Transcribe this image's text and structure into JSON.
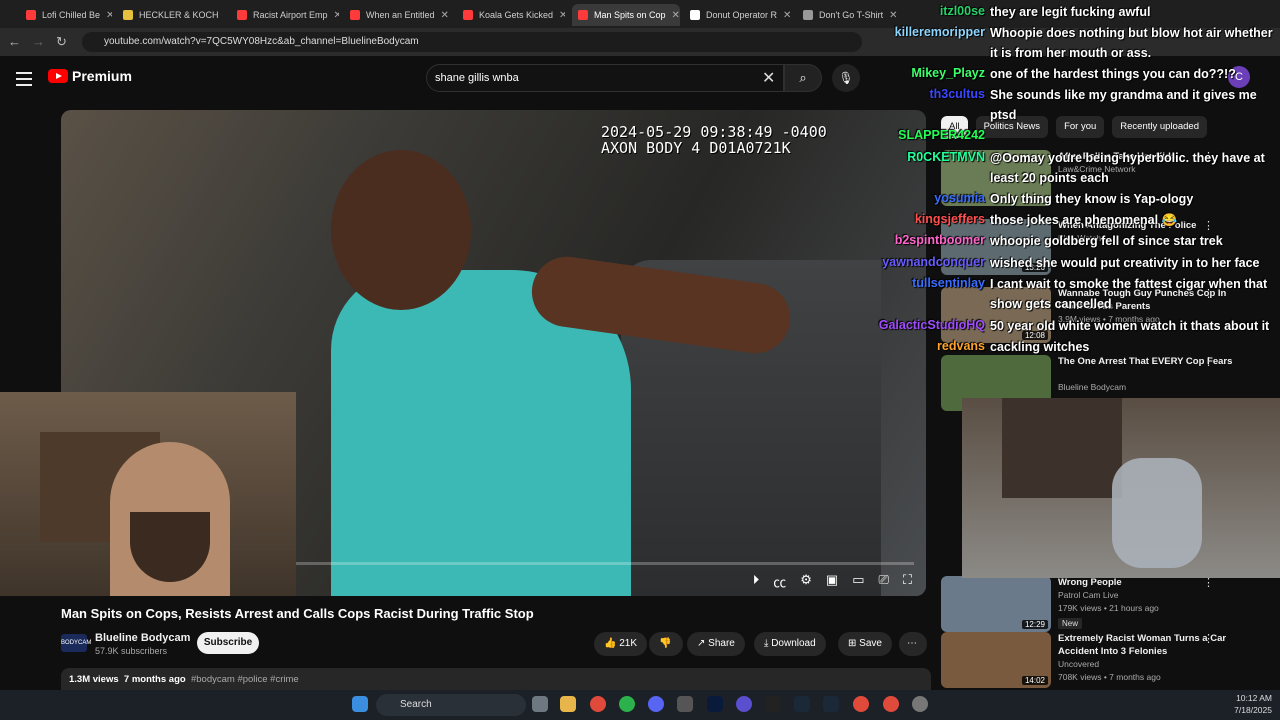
{
  "tabs": [
    {
      "label": "Lofi Chilled Be",
      "color": "#ff3a3a"
    },
    {
      "label": "HECKLER & KOCH",
      "color": "#e5c03c"
    },
    {
      "label": "Racist Airport Emp",
      "color": "#ff3a3a"
    },
    {
      "label": "When an Entitled",
      "color": "#ff3a3a"
    },
    {
      "label": "Koala Gets Kicked",
      "color": "#ff3a3a"
    },
    {
      "label": "Man Spits on Cop",
      "color": "#ff3a3a"
    },
    {
      "label": "Donut Operator R",
      "color": "#ffffff"
    },
    {
      "label": "Don't Go T-Shirt",
      "color": "#999999"
    }
  ],
  "address": {
    "url": "youtube.com/watch?v=7QC5WY08Hzc&ab_channel=BluelineBodycam"
  },
  "header": {
    "logo": "Premium",
    "search_value": "shane gillis wnba",
    "avatar_letter": "C"
  },
  "video": {
    "stamp_line1": "2024-05-29 09:38:49 -0400",
    "stamp_line2": "AXON BODY 4 D01A0721K",
    "progress": 0.0
  },
  "title": "Man Spits on Cops, Resists Arrest and Calls Cops Racist During Traffic Stop",
  "channel": {
    "name": "Blueline Bodycam",
    "subs": "57.9K subscribers",
    "avatar_text": "BODYCAM",
    "subscribe": "Subscribe"
  },
  "actions": {
    "likes": "21K",
    "share": "Share",
    "download": "Download",
    "save": "Save"
  },
  "meta": {
    "views": "1.3M views",
    "age": "7 months ago",
    "tags": "#bodycam #police #crime"
  },
  "filters": [
    "All",
    "Politics News",
    "For you",
    "Recently uploaded"
  ],
  "recs": [
    {
      "title": "After Police Take Her Kids",
      "channel": "Law&Crime Network",
      "meta": "",
      "dur": ""
    },
    {
      "title": "When Antagonizing The Police",
      "channel": "Blue Watch",
      "meta": "",
      "dur": "13:26"
    },
    {
      "title": "Wannabe Tough Guy Punches Cop In Front Of His Parents",
      "channel": "",
      "meta": "3.9M views • 7 months ago",
      "dur": "12:08"
    },
    {
      "title": "The One Arrest That EVERY Cop Fears",
      "channel": "Blueline Bodycam",
      "meta": "",
      "dur": ""
    },
    {
      "title": "Wrong People",
      "channel": "Patrol Cam Live",
      "meta": "179K views • 21 hours ago",
      "dur": "12:29",
      "badge": "New"
    },
    {
      "title": "Extremely Racist Woman Turns a Car Accident Into 3 Felonies",
      "channel": "Uncovered",
      "meta": "708K views • 7 months ago",
      "dur": "14:02"
    }
  ],
  "chat": [
    {
      "name": "itzl00se",
      "color": "#2bd16a",
      "msg": "they are legit fucking awful"
    },
    {
      "name": "killeremoripper",
      "color": "#8fd6ff",
      "msg": "Whoopie does nothing but blow hot air whether it is from her mouth or ass."
    },
    {
      "name": "Mikey_Playz",
      "color": "#3dff6a",
      "msg": "one of the hardest things you can do??!?"
    },
    {
      "name": "th3cultus",
      "color": "#3a48ff",
      "msg": "She sounds like my grandma and it gives me ptsd"
    },
    {
      "name": "SLAPPER4242",
      "color": "#22ff55",
      "msg": ""
    },
    {
      "name": "R0CKETMVN",
      "color": "#22ff9a",
      "msg": "@Oomay youre being hyperbolic. they have at least 20 points each"
    },
    {
      "name": "yosumia",
      "color": "#3a6dff",
      "msg": "Only thing they know is Yap-ology"
    },
    {
      "name": "kingsjeffers",
      "color": "#ff4f4f",
      "msg": "those jokes are phenomenal 😂"
    },
    {
      "name": "b2spintboomer",
      "color": "#ff66cc",
      "msg": "whoopie goldberg fell of since star trek"
    },
    {
      "name": "yawnandconquer",
      "color": "#6a5cff",
      "msg": "wished she would put creativity in to her face"
    },
    {
      "name": "tullsentinlay",
      "color": "#3a6dff",
      "msg": "I cant wait to smoke the fattest cigar when that show gets cancelled"
    },
    {
      "name": "GalacticStudioHQ",
      "color": "#a04cff",
      "msg": "50 year old white women watch it thats about it"
    },
    {
      "name": "redvans",
      "color": "#ffa52b",
      "msg": "cackling witches"
    }
  ],
  "taskbar": {
    "search": "Search",
    "time": "10:12 AM",
    "date": "7/18/2025"
  }
}
